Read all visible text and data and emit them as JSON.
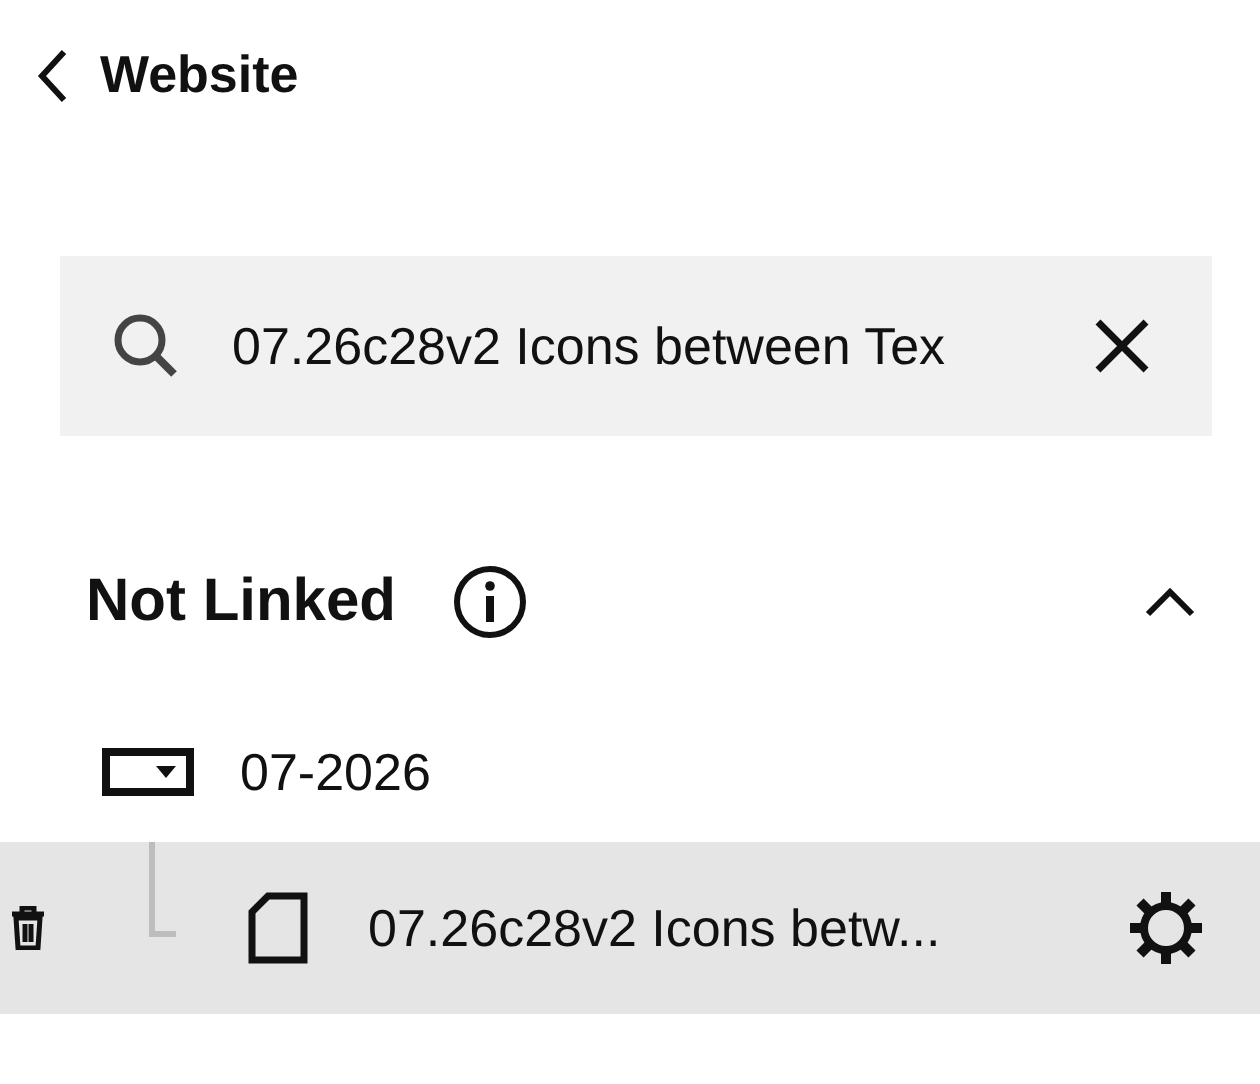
{
  "header": {
    "title": "Website"
  },
  "search": {
    "value": "07.26c28v2 Icons between Tex"
  },
  "section": {
    "title": "Not Linked",
    "expanded": true,
    "items": [
      {
        "label": "07-2026",
        "kind": "folder",
        "children": [
          {
            "label": "07.26c28v2 Icons betw...",
            "kind": "page",
            "selected": true
          }
        ]
      }
    ]
  }
}
